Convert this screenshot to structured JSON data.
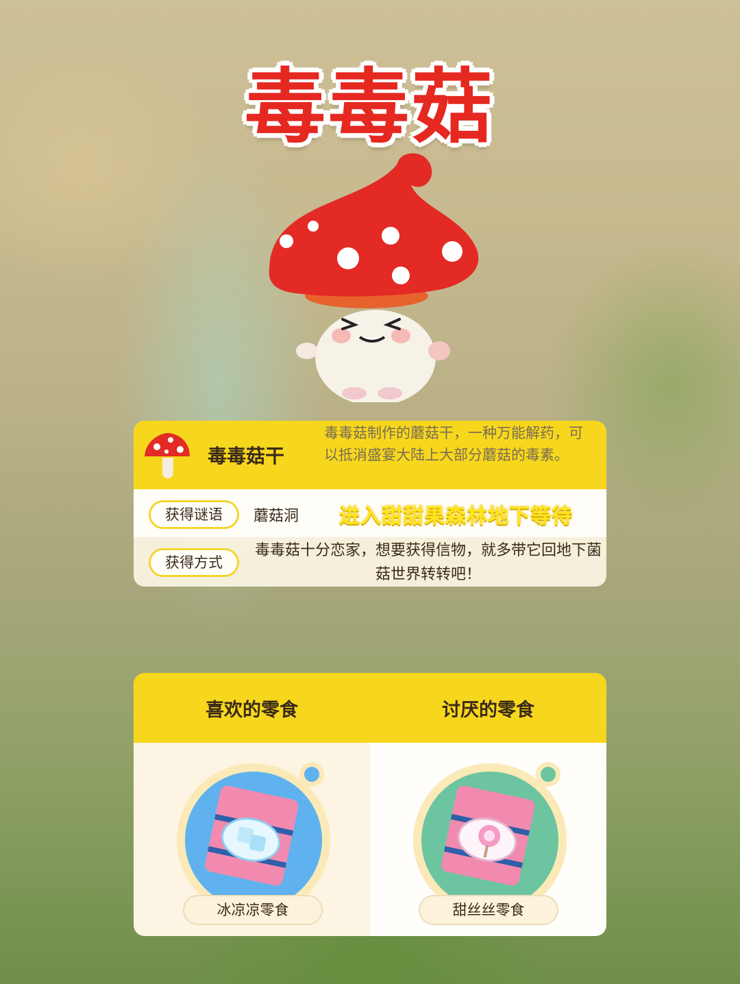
{
  "title": "毒毒菇",
  "item": {
    "name": "毒毒菇干",
    "description": "毒毒菇制作的蘑菇干，一种万能解药，可以抵消盛宴大陆上大部分蘑菇的毒素。",
    "icon": "mushroom-icon"
  },
  "riddle": {
    "label": "获得谜语",
    "location": "蘑菇洞",
    "hint": "进入甜甜果森林地下等待"
  },
  "method": {
    "label": "获得方式",
    "text": "毒毒菇十分恋家，想要获得信物，就多带它回地下菌菇世界转转吧！"
  },
  "snacks": {
    "liked_title": "喜欢的零食",
    "disliked_title": "讨厌的零食",
    "liked": {
      "name": "冰凉凉零食",
      "icon": "ice-candy-icon",
      "color": "#5fb2ee"
    },
    "disliked": {
      "name": "甜丝丝零食",
      "icon": "lollipop-candy-icon",
      "color": "#6cc4a0"
    }
  },
  "colors": {
    "title": "#e52820",
    "header": "#f7d71d",
    "hint": "#ffe51f"
  }
}
